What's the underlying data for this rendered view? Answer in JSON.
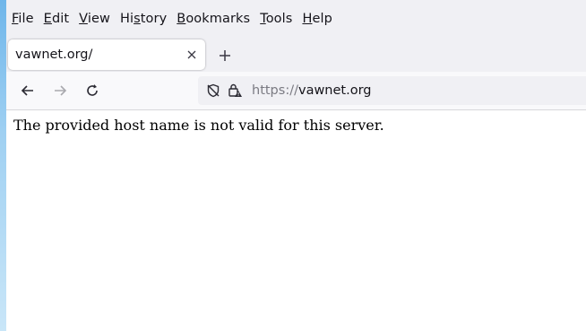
{
  "menubar": {
    "items": [
      {
        "label_u": "F",
        "label_rest": "ile"
      },
      {
        "label_u": "E",
        "label_rest": "dit"
      },
      {
        "label_u": "V",
        "label_rest": "iew"
      },
      {
        "label_pre": "Hi",
        "label_u": "s",
        "label_rest": "tory"
      },
      {
        "label_u": "B",
        "label_rest": "ookmarks"
      },
      {
        "label_u": "T",
        "label_rest": "ools"
      },
      {
        "label_u": "H",
        "label_rest": "elp"
      }
    ]
  },
  "tab": {
    "title": "vawnet.org/"
  },
  "urlbar": {
    "scheme": "https://",
    "host": "vawnet.org"
  },
  "page": {
    "message": "The provided host name is not valid for this server."
  },
  "icons": {
    "tab_close": "close-icon",
    "new_tab": "plus-icon",
    "back": "arrow-left-icon",
    "forward": "arrow-right-icon",
    "reload": "reload-icon",
    "tracking": "shield-slash-icon",
    "lock": "lock-warning-icon"
  }
}
